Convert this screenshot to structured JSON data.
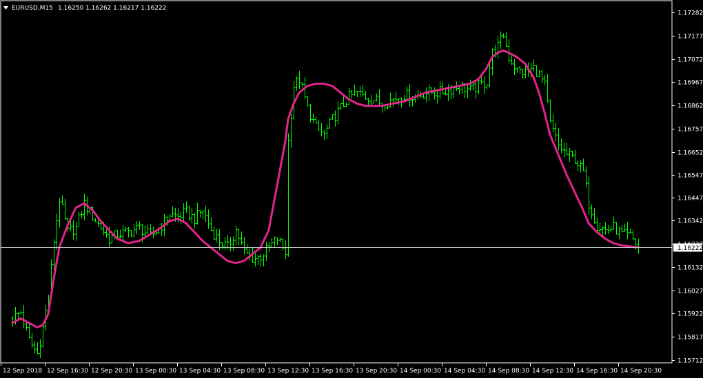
{
  "window": {
    "symbol_timeframe": "EURUSD,M15",
    "ohlc": "1.16250 1.16262 1.16217 1.16222"
  },
  "colors": {
    "background": "#000000",
    "frame": "#ffffff",
    "bars": "#00ff00",
    "moving_average": "#e3248c",
    "price_line": "#c0c0c0",
    "price_label_bg": "#ffffff",
    "price_label_text": "#000000"
  },
  "chart_data": {
    "type": "ohlc",
    "symbol": "EURUSD",
    "timeframe": "M15",
    "current_price": 1.16222,
    "current_price_label": "1.16222",
    "ylim": [
      1.15712,
      1.17282
    ],
    "ytick_labels": [
      "1.17282",
      "1.17177",
      "1.17072",
      "1.16967",
      "1.16862",
      "1.16757",
      "1.16652",
      "1.16547",
      "1.16447",
      "1.16342",
      "1.16237",
      "1.16132",
      "1.16027",
      "1.15922",
      "1.15817",
      "1.15712"
    ],
    "ytick_values": [
      1.17282,
      1.17177,
      1.17072,
      1.16967,
      1.16862,
      1.16757,
      1.16652,
      1.16547,
      1.16447,
      1.16342,
      1.16237,
      1.16132,
      1.16027,
      1.15922,
      1.15817,
      1.15712
    ],
    "xtick_labels": [
      "12 Sep 2018",
      "12 Sep 16:30",
      "12 Sep 20:30",
      "13 Sep 00:30",
      "13 Sep 04:30",
      "13 Sep 08:30",
      "13 Sep 12:30",
      "13 Sep 16:30",
      "13 Sep 20:30",
      "14 Sep 00:30",
      "14 Sep 04:30",
      "14 Sep 08:30",
      "14 Sep 12:30",
      "14 Sep 16:30",
      "14 Sep 20:30"
    ],
    "price_path": [
      [
        "12 Sep 2018 12:30",
        1.159
      ],
      [
        "12 Sep 2018 13:15",
        1.1593
      ],
      [
        "12 Sep 2018 14:00",
        1.158
      ],
      [
        "12 Sep 2018 14:45",
        1.1574
      ],
      [
        "12 Sep 2018 15:15",
        1.1586
      ],
      [
        "12 Sep 2018 15:45",
        1.16
      ],
      [
        "12 Sep 2018 16:15",
        1.1625
      ],
      [
        "12 Sep 2018 16:45",
        1.1644
      ],
      [
        "12 Sep 2018 17:30",
        1.1629
      ],
      [
        "12 Sep 2018 18:15",
        1.1631
      ],
      [
        "12 Sep 2018 19:00",
        1.1642
      ],
      [
        "12 Sep 2018 19:45",
        1.1636
      ],
      [
        "12 Sep 2018 20:30",
        1.1631
      ],
      [
        "12 Sep 2018 21:15",
        1.1626
      ],
      [
        "12 Sep 2018 22:00",
        1.1628
      ],
      [
        "12 Sep 2018 23:00",
        1.1629
      ],
      [
        "13 Sep 2018 00:00",
        1.1631
      ],
      [
        "13 Sep 2018 01:00",
        1.1627
      ],
      [
        "13 Sep 2018 02:00",
        1.1632
      ],
      [
        "13 Sep 2018 02:45",
        1.1637
      ],
      [
        "13 Sep 2018 03:30",
        1.1636
      ],
      [
        "13 Sep 2018 04:15",
        1.1638
      ],
      [
        "13 Sep 2018 05:00",
        1.1635
      ],
      [
        "13 Sep 2018 05:45",
        1.1639
      ],
      [
        "13 Sep 2018 06:30",
        1.163
      ],
      [
        "13 Sep 2018 07:15",
        1.1625
      ],
      [
        "13 Sep 2018 08:00",
        1.1622
      ],
      [
        "13 Sep 2018 08:45",
        1.163
      ],
      [
        "13 Sep 2018 09:30",
        1.162
      ],
      [
        "13 Sep 2018 10:15",
        1.1617
      ],
      [
        "13 Sep 2018 11:00",
        1.1618
      ],
      [
        "13 Sep 2018 11:45",
        1.1622
      ],
      [
        "13 Sep 2018 12:30",
        1.1626
      ],
      [
        "13 Sep 2018 13:15",
        1.162
      ],
      [
        "13 Sep 2018 13:30",
        1.167
      ],
      [
        "13 Sep 2018 14:00",
        1.1695
      ],
      [
        "13 Sep 2018 14:30",
        1.1698
      ],
      [
        "13 Sep 2018 15:15",
        1.1685
      ],
      [
        "13 Sep 2018 16:00",
        1.1676
      ],
      [
        "13 Sep 2018 16:45",
        1.1673
      ],
      [
        "13 Sep 2018 17:30",
        1.168
      ],
      [
        "13 Sep 2018 18:15",
        1.1685
      ],
      [
        "13 Sep 2018 19:00",
        1.169
      ],
      [
        "13 Sep 2018 19:45",
        1.1692
      ],
      [
        "13 Sep 2018 20:30",
        1.169
      ],
      [
        "13 Sep 2018 21:15",
        1.1689
      ],
      [
        "13 Sep 2018 22:00",
        1.1687
      ],
      [
        "13 Sep 2018 23:00",
        1.1689
      ],
      [
        "14 Sep 2018 00:00",
        1.1691
      ],
      [
        "14 Sep 2018 01:00",
        1.169
      ],
      [
        "14 Sep 2018 02:00",
        1.1692
      ],
      [
        "14 Sep 2018 03:00",
        1.1692
      ],
      [
        "14 Sep 2018 04:00",
        1.1693
      ],
      [
        "14 Sep 2018 05:00",
        1.1695
      ],
      [
        "14 Sep 2018 06:00",
        1.1693
      ],
      [
        "14 Sep 2018 06:45",
        1.1695
      ],
      [
        "14 Sep 2018 07:30",
        1.1697
      ],
      [
        "14 Sep 2018 08:00",
        1.171
      ],
      [
        "14 Sep 2018 08:30",
        1.1713
      ],
      [
        "14 Sep 2018 09:00",
        1.1718
      ],
      [
        "14 Sep 2018 09:30",
        1.1708
      ],
      [
        "14 Sep 2018 10:15",
        1.1702
      ],
      [
        "14 Sep 2018 11:00",
        1.1701
      ],
      [
        "14 Sep 2018 11:45",
        1.1703
      ],
      [
        "14 Sep 2018 12:15",
        1.17
      ],
      [
        "14 Sep 2018 12:45",
        1.1695
      ],
      [
        "14 Sep 2018 13:15",
        1.1678
      ],
      [
        "14 Sep 2018 14:00",
        1.1668
      ],
      [
        "14 Sep 2018 14:45",
        1.1664
      ],
      [
        "14 Sep 2018 15:30",
        1.1662
      ],
      [
        "14 Sep 2018 16:15",
        1.1656
      ],
      [
        "14 Sep 2018 16:45",
        1.1642
      ],
      [
        "14 Sep 2018 17:30",
        1.1632
      ],
      [
        "14 Sep 2018 18:15",
        1.163
      ],
      [
        "14 Sep 2018 19:00",
        1.1631
      ],
      [
        "14 Sep 2018 19:45",
        1.1628
      ],
      [
        "14 Sep 2018 20:30",
        1.1627
      ],
      [
        "14 Sep 2018 21:00",
        1.1624
      ],
      [
        "14 Sep 2018 21:15",
        1.16222
      ]
    ],
    "moving_average": [
      [
        "12 Sep 2018 12:30",
        1.1588
      ],
      [
        "12 Sep 2018 13:15",
        1.159
      ],
      [
        "12 Sep 2018 14:00",
        1.1588
      ],
      [
        "12 Sep 2018 14:45",
        1.1586
      ],
      [
        "12 Sep 2018 15:15",
        1.1587
      ],
      [
        "12 Sep 2018 15:45",
        1.1592
      ],
      [
        "12 Sep 2018 16:15",
        1.1608
      ],
      [
        "12 Sep 2018 16:45",
        1.1622
      ],
      [
        "12 Sep 2018 17:30",
        1.1632
      ],
      [
        "12 Sep 2018 18:15",
        1.164
      ],
      [
        "12 Sep 2018 19:00",
        1.1642
      ],
      [
        "12 Sep 2018 19:45",
        1.1639
      ],
      [
        "12 Sep 2018 20:30",
        1.1634
      ],
      [
        "12 Sep 2018 21:15",
        1.163
      ],
      [
        "12 Sep 2018 22:00",
        1.1626
      ],
      [
        "12 Sep 2018 23:00",
        1.1624
      ],
      [
        "13 Sep 2018 00:00",
        1.1625
      ],
      [
        "13 Sep 2018 01:00",
        1.1628
      ],
      [
        "13 Sep 2018 02:00",
        1.1631
      ],
      [
        "13 Sep 2018 02:45",
        1.1634
      ],
      [
        "13 Sep 2018 03:30",
        1.1635
      ],
      [
        "13 Sep 2018 04:15",
        1.1633
      ],
      [
        "13 Sep 2018 05:00",
        1.1629
      ],
      [
        "13 Sep 2018 05:45",
        1.1625
      ],
      [
        "13 Sep 2018 06:30",
        1.1622
      ],
      [
        "13 Sep 2018 07:15",
        1.1619
      ],
      [
        "13 Sep 2018 08:00",
        1.1616
      ],
      [
        "13 Sep 2018 08:45",
        1.1615
      ],
      [
        "13 Sep 2018 09:30",
        1.1616
      ],
      [
        "13 Sep 2018 10:15",
        1.1619
      ],
      [
        "13 Sep 2018 11:00",
        1.1622
      ],
      [
        "13 Sep 2018 11:45",
        1.163
      ],
      [
        "13 Sep 2018 12:30",
        1.165
      ],
      [
        "13 Sep 2018 13:15",
        1.167
      ],
      [
        "13 Sep 2018 13:30",
        1.168
      ],
      [
        "13 Sep 2018 14:00",
        1.1687
      ],
      [
        "13 Sep 2018 14:30",
        1.1692
      ],
      [
        "13 Sep 2018 15:15",
        1.1695
      ],
      [
        "13 Sep 2018 16:00",
        1.1696
      ],
      [
        "13 Sep 2018 16:45",
        1.1696
      ],
      [
        "13 Sep 2018 17:30",
        1.1695
      ],
      [
        "13 Sep 2018 18:15",
        1.1692
      ],
      [
        "13 Sep 2018 19:00",
        1.1689
      ],
      [
        "13 Sep 2018 19:45",
        1.1687
      ],
      [
        "13 Sep 2018 20:30",
        1.1686
      ],
      [
        "13 Sep 2018 21:15",
        1.1686
      ],
      [
        "13 Sep 2018 22:00",
        1.1686
      ],
      [
        "13 Sep 2018 23:00",
        1.1687
      ],
      [
        "14 Sep 2018 00:00",
        1.1688
      ],
      [
        "14 Sep 2018 01:00",
        1.169
      ],
      [
        "14 Sep 2018 02:00",
        1.1692
      ],
      [
        "14 Sep 2018 03:00",
        1.1693
      ],
      [
        "14 Sep 2018 04:00",
        1.1694
      ],
      [
        "14 Sep 2018 05:00",
        1.1695
      ],
      [
        "14 Sep 2018 06:00",
        1.1696
      ],
      [
        "14 Sep 2018 06:45",
        1.1698
      ],
      [
        "14 Sep 2018 07:30",
        1.1703
      ],
      [
        "14 Sep 2018 08:00",
        1.1708
      ],
      [
        "14 Sep 2018 08:30",
        1.171
      ],
      [
        "14 Sep 2018 09:00",
        1.1711
      ],
      [
        "14 Sep 2018 09:30",
        1.171
      ],
      [
        "14 Sep 2018 10:15",
        1.1708
      ],
      [
        "14 Sep 2018 11:00",
        1.1705
      ],
      [
        "14 Sep 2018 11:45",
        1.1699
      ],
      [
        "14 Sep 2018 12:15",
        1.1692
      ],
      [
        "14 Sep 2018 12:45",
        1.1683
      ],
      [
        "14 Sep 2018 13:15",
        1.1673
      ],
      [
        "14 Sep 2018 14:00",
        1.1664
      ],
      [
        "14 Sep 2018 14:45",
        1.1655
      ],
      [
        "14 Sep 2018 15:30",
        1.1647
      ],
      [
        "14 Sep 2018 16:15",
        1.1639
      ],
      [
        "14 Sep 2018 16:45",
        1.1633
      ],
      [
        "14 Sep 2018 17:30",
        1.1629
      ],
      [
        "14 Sep 2018 18:15",
        1.1626
      ],
      [
        "14 Sep 2018 19:00",
        1.1624
      ],
      [
        "14 Sep 2018 19:45",
        1.1623
      ],
      [
        "14 Sep 2018 20:30",
        1.16225
      ],
      [
        "14 Sep 2018 21:00",
        1.16222
      ],
      [
        "14 Sep 2018 21:15",
        1.16222
      ]
    ]
  }
}
